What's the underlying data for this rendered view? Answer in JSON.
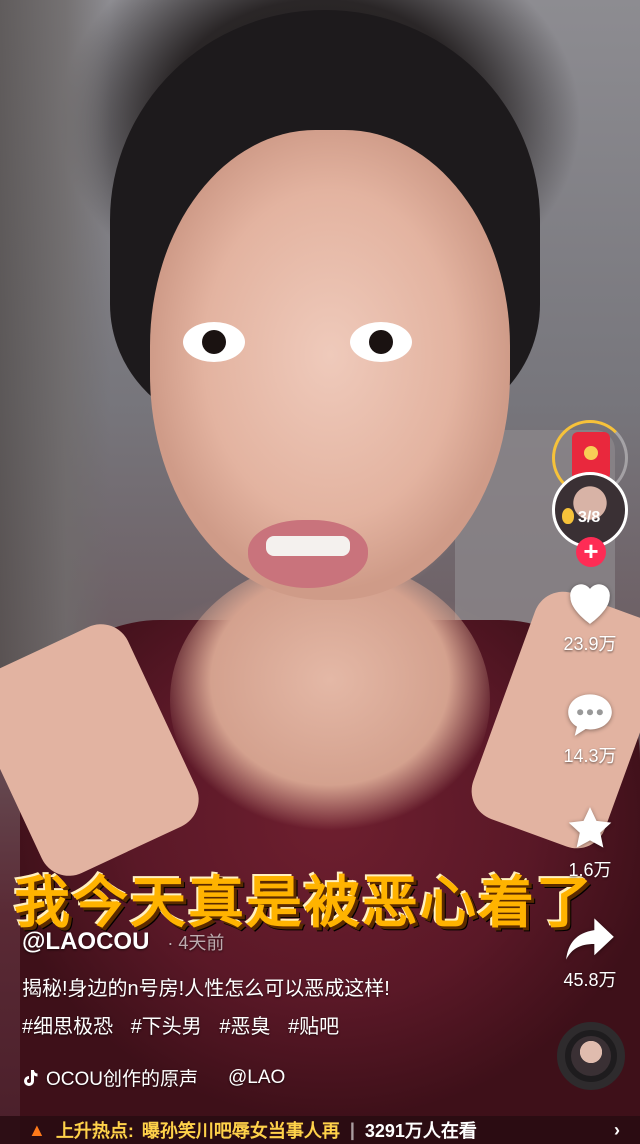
{
  "caption": "我今天真是被恶心着了",
  "side_actions": {
    "redpack_progress": "3/8",
    "like_count": "23.9万",
    "comment_count": "14.3万",
    "favorite_count": "1.6万",
    "share_count": "45.8万"
  },
  "post": {
    "author": "@LAOCOU",
    "time_ago": "· 4天前",
    "description": "揭秘!身边的n号房!人性怎么可以恶成这样!",
    "tags": [
      "#细思极恐",
      "#下头男",
      "#恶臭",
      "#贴吧"
    ],
    "music_title": "OCOU创作的原声",
    "music_author": "@LAO"
  },
  "hot_bar": {
    "label": "上升热点:",
    "topic": "曝孙笑川吧辱女当事人再",
    "viewers": "3291万人在看",
    "arrow": "›"
  },
  "colors": {
    "accent": "#fe2c55",
    "caption": "#ffb300",
    "gold": "#f6c23a"
  },
  "icons": [
    "heart-icon",
    "comment-icon",
    "star-icon",
    "share-icon",
    "red-envelope-icon",
    "music-note-icon",
    "flame-icon"
  ]
}
